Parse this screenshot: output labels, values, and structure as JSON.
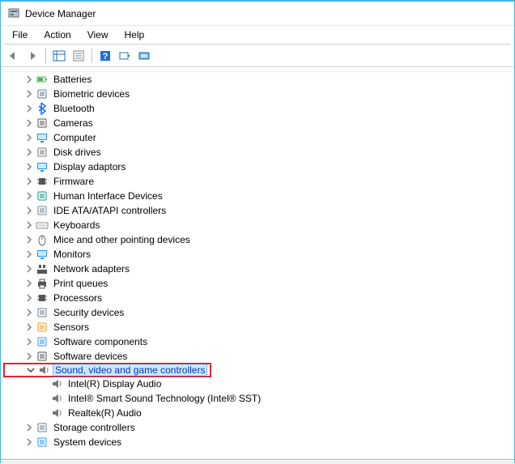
{
  "window": {
    "title": "Device Manager"
  },
  "menu": {
    "file": "File",
    "action": "Action",
    "view": "View",
    "help": "Help"
  },
  "toolbar": {
    "back": "Back",
    "forward": "Forward",
    "details": "Show hidden",
    "properties": "Properties",
    "help": "Help",
    "update": "Update",
    "scan": "Scan"
  },
  "tree": {
    "items": [
      {
        "id": "batteries",
        "label": "Batteries",
        "level": 1,
        "expanded": false,
        "icon": "battery",
        "selected": false
      },
      {
        "id": "biometric",
        "label": "Biometric devices",
        "level": 1,
        "expanded": false,
        "icon": "fingerprint",
        "selected": false
      },
      {
        "id": "bluetooth",
        "label": "Bluetooth",
        "level": 1,
        "expanded": false,
        "icon": "bluetooth",
        "selected": false
      },
      {
        "id": "cameras",
        "label": "Cameras",
        "level": 1,
        "expanded": false,
        "icon": "camera",
        "selected": false
      },
      {
        "id": "computer",
        "label": "Computer",
        "level": 1,
        "expanded": false,
        "icon": "computer",
        "selected": false
      },
      {
        "id": "diskdrives",
        "label": "Disk drives",
        "level": 1,
        "expanded": false,
        "icon": "disk",
        "selected": false
      },
      {
        "id": "display",
        "label": "Display adaptors",
        "level": 1,
        "expanded": false,
        "icon": "display",
        "selected": false
      },
      {
        "id": "firmware",
        "label": "Firmware",
        "level": 1,
        "expanded": false,
        "icon": "chip",
        "selected": false
      },
      {
        "id": "hid",
        "label": "Human Interface Devices",
        "level": 1,
        "expanded": false,
        "icon": "hid",
        "selected": false
      },
      {
        "id": "ide",
        "label": "IDE ATA/ATAPI controllers",
        "level": 1,
        "expanded": false,
        "icon": "ide",
        "selected": false
      },
      {
        "id": "keyboards",
        "label": "Keyboards",
        "level": 1,
        "expanded": false,
        "icon": "keyboard",
        "selected": false
      },
      {
        "id": "mice",
        "label": "Mice and other pointing devices",
        "level": 1,
        "expanded": false,
        "icon": "mouse",
        "selected": false
      },
      {
        "id": "monitors",
        "label": "Monitors",
        "level": 1,
        "expanded": false,
        "icon": "monitor",
        "selected": false
      },
      {
        "id": "network",
        "label": "Network adapters",
        "level": 1,
        "expanded": false,
        "icon": "network",
        "selected": false
      },
      {
        "id": "printq",
        "label": "Print queues",
        "level": 1,
        "expanded": false,
        "icon": "printer",
        "selected": false
      },
      {
        "id": "processors",
        "label": "Processors",
        "level": 1,
        "expanded": false,
        "icon": "cpu",
        "selected": false
      },
      {
        "id": "security",
        "label": "Security devices",
        "level": 1,
        "expanded": false,
        "icon": "security",
        "selected": false
      },
      {
        "id": "sensors",
        "label": "Sensors",
        "level": 1,
        "expanded": false,
        "icon": "sensor",
        "selected": false
      },
      {
        "id": "swcomp",
        "label": "Software components",
        "level": 1,
        "expanded": false,
        "icon": "swcomp",
        "selected": false
      },
      {
        "id": "swdev",
        "label": "Software devices",
        "level": 1,
        "expanded": false,
        "icon": "swdev",
        "selected": false
      },
      {
        "id": "sound",
        "label": "Sound, video and game controllers",
        "level": 1,
        "expanded": true,
        "icon": "speaker",
        "selected": true,
        "highlighted": true
      },
      {
        "id": "sound-c1",
        "label": "Intel(R) Display Audio",
        "level": 2,
        "expanded": null,
        "icon": "speaker",
        "selected": false
      },
      {
        "id": "sound-c2",
        "label": "Intel® Smart Sound Technology (Intel® SST)",
        "level": 2,
        "expanded": null,
        "icon": "speaker",
        "selected": false
      },
      {
        "id": "sound-c3",
        "label": "Realtek(R) Audio",
        "level": 2,
        "expanded": null,
        "icon": "speaker",
        "selected": false
      },
      {
        "id": "storage",
        "label": "Storage controllers",
        "level": 1,
        "expanded": false,
        "icon": "storage",
        "selected": false
      },
      {
        "id": "system",
        "label": "System devices",
        "level": 1,
        "expanded": false,
        "icon": "system",
        "selected": false
      }
    ]
  },
  "icons": {
    "battery": "#4caf50",
    "fingerprint": "#607d8b",
    "bluetooth": "#0d6efd",
    "camera": "#555",
    "computer": "#2196f3",
    "disk": "#777",
    "display": "#2196f3",
    "chip": "#555",
    "hid": "#009688",
    "ide": "#708090",
    "keyboard": "#888",
    "mouse": "#666",
    "monitor": "#2196f3",
    "network": "#555",
    "printer": "#555",
    "cpu": "#555",
    "security": "#708090",
    "sensor": "#ff9800",
    "swcomp": "#2196f3",
    "swdev": "#555",
    "speaker": "#777",
    "storage": "#708090",
    "system": "#2196f3"
  }
}
